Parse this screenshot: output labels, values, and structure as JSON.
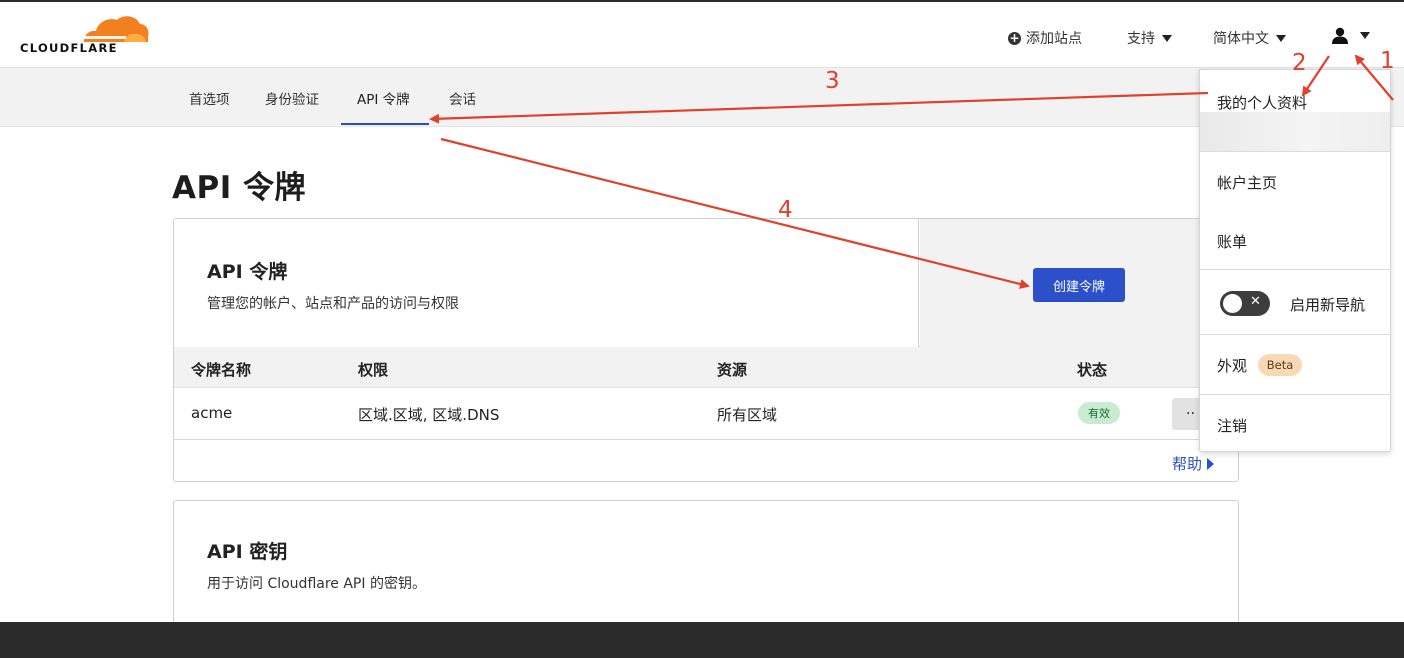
{
  "header": {
    "logo_text": "CLOUDFLARE",
    "add_site": "添加站点",
    "support": "支持",
    "language": "简体中文"
  },
  "subnav": {
    "tabs": [
      {
        "label": "首选项"
      },
      {
        "label": "身份验证"
      },
      {
        "label": "API 令牌",
        "active": true
      },
      {
        "label": "会话"
      }
    ]
  },
  "page_title": "API 令牌",
  "tokens_card": {
    "title": "API 令牌",
    "description": "管理您的帐户、站点和产品的访问与权限",
    "create_button": "创建令牌",
    "columns": [
      "令牌名称",
      "权限",
      "资源",
      "状态"
    ],
    "rows": [
      {
        "name": "acme",
        "permissions": "区域.区域, 区域.DNS",
        "resources": "所有区域",
        "status": "有效",
        "more": "··"
      }
    ],
    "help_link": "帮助"
  },
  "keys_card": {
    "title": "API 密钥",
    "description": "用于访问 Cloudflare API 的密钥。"
  },
  "user_menu": {
    "items": {
      "profile": "我的个人资料",
      "account_home": "帐户主页",
      "billing": "账单",
      "new_nav": "启用新导航",
      "appearance": "外观",
      "beta": "Beta",
      "logout": "注销"
    }
  },
  "annotations": [
    "1",
    "2",
    "3",
    "4"
  ],
  "colors": {
    "brand_orange": "#f38020",
    "primary_blue": "#2c4fca",
    "annotation_red": "#e0402c",
    "status_green_bg": "#c8ebd2"
  }
}
